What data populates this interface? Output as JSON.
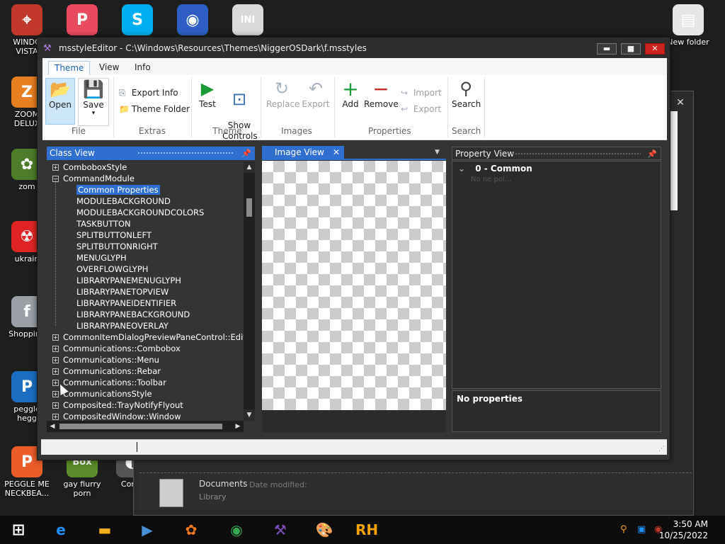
{
  "desktop": {
    "icons": [
      {
        "label": "WINDO\nVISTA",
        "glyph": "⌖",
        "color": "#c0392b"
      },
      {
        "label": "",
        "glyph": "P",
        "color": "#e84a5f"
      },
      {
        "label": "",
        "glyph": "S",
        "color": "#00aff0"
      },
      {
        "label": "",
        "glyph": "◉",
        "color": "#2d5fc4"
      },
      {
        "label": "",
        "glyph": "INI",
        "color": "#d9d9d9"
      },
      {
        "label": "New folder",
        "glyph": "▤",
        "color": "#e6e6e6"
      },
      {
        "label": "ZOOM\nDELUX",
        "glyph": "Z",
        "color": "#e67e22"
      },
      {
        "label": "zom",
        "glyph": "✿",
        "color": "#4e7d2a"
      },
      {
        "label": "ukrain",
        "glyph": "☢",
        "color": "#e02424"
      },
      {
        "label": "Shopping",
        "glyph": "f",
        "color": "#9aa0a6"
      },
      {
        "label": "peggle\nhegg",
        "glyph": "P",
        "color": "#1b6ec2"
      },
      {
        "label": "PEGGLE ME\nNECKBEA...",
        "glyph": "P",
        "color": "#e85d2a"
      },
      {
        "label": "gay fiurry\nporn",
        "glyph": "Box",
        "color": "#5a8a2a"
      },
      {
        "label": "Contr",
        "glyph": "◐",
        "color": "#555"
      }
    ]
  },
  "background_window": {
    "close_label": "✕",
    "row": {
      "name": "Documents",
      "meta_label": "Date modified:",
      "sub": "Library"
    },
    "help_label": "?"
  },
  "window": {
    "title": "msstyleEditor - C:\\Windows\\Resources\\Themes\\NiggerOSDark\\f.msstyles",
    "app_icon": "⚒",
    "buttons": {
      "minimize": "▬",
      "maximize": "■",
      "close": "✕"
    },
    "tabs": [
      "Theme",
      "View",
      "Info"
    ],
    "ribbon": {
      "open": "Open",
      "save": "Save",
      "save_arrow": "▾",
      "export_info": "Export Info",
      "theme_folder": "Theme Folder",
      "test": "Test",
      "show_controls": "Show\nControls",
      "replace": "Replace",
      "export": "Export",
      "add": "Add",
      "remove": "Remove",
      "import_small": "Import",
      "export_small": "Export",
      "search": "Search",
      "groups": {
        "file": "File",
        "extras": "Extras",
        "theme": "Theme",
        "images": "Images",
        "properties": "Properties",
        "search": "Search"
      }
    },
    "class_view": {
      "header": "Class View",
      "pin": "📌",
      "items": [
        {
          "label": "ComboboxStyle",
          "level": 0,
          "expander": "+"
        },
        {
          "label": "CommandModule",
          "level": 0,
          "expander": "−"
        },
        {
          "label": "Common Properties",
          "level": 1,
          "expander": "",
          "selected": true
        },
        {
          "label": "MODULEBACKGROUND",
          "level": 1,
          "expander": ""
        },
        {
          "label": "MODULEBACKGROUNDCOLORS",
          "level": 1,
          "expander": ""
        },
        {
          "label": "TASKBUTTON",
          "level": 1,
          "expander": ""
        },
        {
          "label": "SPLITBUTTONLEFT",
          "level": 1,
          "expander": ""
        },
        {
          "label": "SPLITBUTTONRIGHT",
          "level": 1,
          "expander": ""
        },
        {
          "label": "MENUGLYPH",
          "level": 1,
          "expander": ""
        },
        {
          "label": "OVERFLOWGLYPH",
          "level": 1,
          "expander": ""
        },
        {
          "label": "LIBRARYPANEMENUGLYPH",
          "level": 1,
          "expander": ""
        },
        {
          "label": "LIBRARYPANETOPVIEW",
          "level": 1,
          "expander": ""
        },
        {
          "label": "LIBRARYPANEIDENTIFIER",
          "level": 1,
          "expander": ""
        },
        {
          "label": "LIBRARYPANEBACKGROUND",
          "level": 1,
          "expander": ""
        },
        {
          "label": "LIBRARYPANEOVERLAY",
          "level": 1,
          "expander": ""
        },
        {
          "label": "CommonItemDialogPreviewPaneControl::Edit",
          "level": 0,
          "expander": "+"
        },
        {
          "label": "Communications::Combobox",
          "level": 0,
          "expander": "+"
        },
        {
          "label": "Communications::Menu",
          "level": 0,
          "expander": "+"
        },
        {
          "label": "Communications::Rebar",
          "level": 0,
          "expander": "+"
        },
        {
          "label": "Communications::Toolbar",
          "level": 0,
          "expander": "+"
        },
        {
          "label": "CommunicationsStyle",
          "level": 0,
          "expander": "+"
        },
        {
          "label": "Composited::TrayNotifyFlyout",
          "level": 0,
          "expander": "+"
        },
        {
          "label": "CompositedWindow::Window",
          "level": 0,
          "expander": "+"
        }
      ]
    },
    "image_view": {
      "tab": "Image View",
      "close": "✕",
      "dropdown": "▼"
    },
    "property_view": {
      "header": "Property View",
      "pin": "📌",
      "section": "0 - Common",
      "section_arrow": "⌄",
      "sub": "No ne pol...",
      "desc": "No properties"
    },
    "status": {
      "text": "",
      "grip": "⋰"
    }
  },
  "taskbar": {
    "start": "⊞",
    "apps": [
      {
        "name": "ie",
        "glyph": "e",
        "color": "#1e90ff"
      },
      {
        "name": "explorer",
        "glyph": "▬",
        "color": "#f2b01e"
      },
      {
        "name": "media",
        "glyph": "▶",
        "color": "#4a90d9"
      },
      {
        "name": "uc",
        "glyph": "✿",
        "color": "#f47b20"
      },
      {
        "name": "chrome",
        "glyph": "◉",
        "color": "#34a853"
      },
      {
        "name": "msstyle",
        "glyph": "⚒",
        "color": "#7b4fb7"
      },
      {
        "name": "paint",
        "glyph": "🎨",
        "color": "#6aa2d8"
      },
      {
        "name": "rh",
        "glyph": "RH",
        "color": "#f4a300"
      }
    ],
    "tray": [
      "⚲",
      "▣",
      "◉"
    ],
    "time": "3:50 AM",
    "date": "10/25/2022"
  },
  "colors": {
    "accent": "#2f6fd0",
    "panel": "#343434"
  }
}
